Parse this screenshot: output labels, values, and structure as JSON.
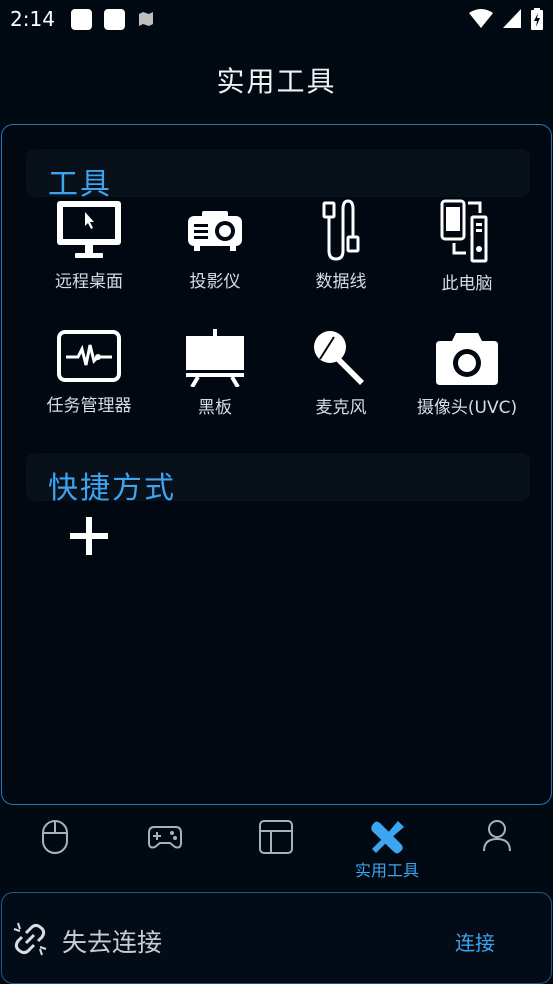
{
  "status_bar": {
    "time": "2:14"
  },
  "header": {
    "title": "实用工具"
  },
  "tools_section": {
    "title": "工具",
    "items": [
      {
        "label": "远程桌面",
        "icon": "monitor-cursor-icon"
      },
      {
        "label": "投影仪",
        "icon": "projector-icon"
      },
      {
        "label": "数据线",
        "icon": "usb-cable-icon"
      },
      {
        "label": "此电脑",
        "icon": "computer-phone-icon"
      },
      {
        "label": "任务管理器",
        "icon": "task-monitor-icon"
      },
      {
        "label": "黑板",
        "icon": "blackboard-icon"
      },
      {
        "label": "麦克风",
        "icon": "microphone-icon"
      },
      {
        "label": "摄像头(UVC)",
        "icon": "camera-icon"
      }
    ]
  },
  "shortcuts_section": {
    "title": "快捷方式",
    "add_icon": "plus-icon"
  },
  "bottom_nav": {
    "items": [
      {
        "icon": "mouse-icon",
        "label": ""
      },
      {
        "icon": "gamepad-icon",
        "label": ""
      },
      {
        "icon": "layout-icon",
        "label": ""
      },
      {
        "icon": "wrench-screwdriver-icon",
        "label": "实用工具"
      },
      {
        "icon": "person-icon",
        "label": ""
      }
    ],
    "active_index": 3
  },
  "connection": {
    "status": "失去连接",
    "action": "连接",
    "icon": "broken-link-icon"
  },
  "colors": {
    "accent": "#3ca4f0",
    "background": "#010a12",
    "border": "#2a74b4"
  }
}
